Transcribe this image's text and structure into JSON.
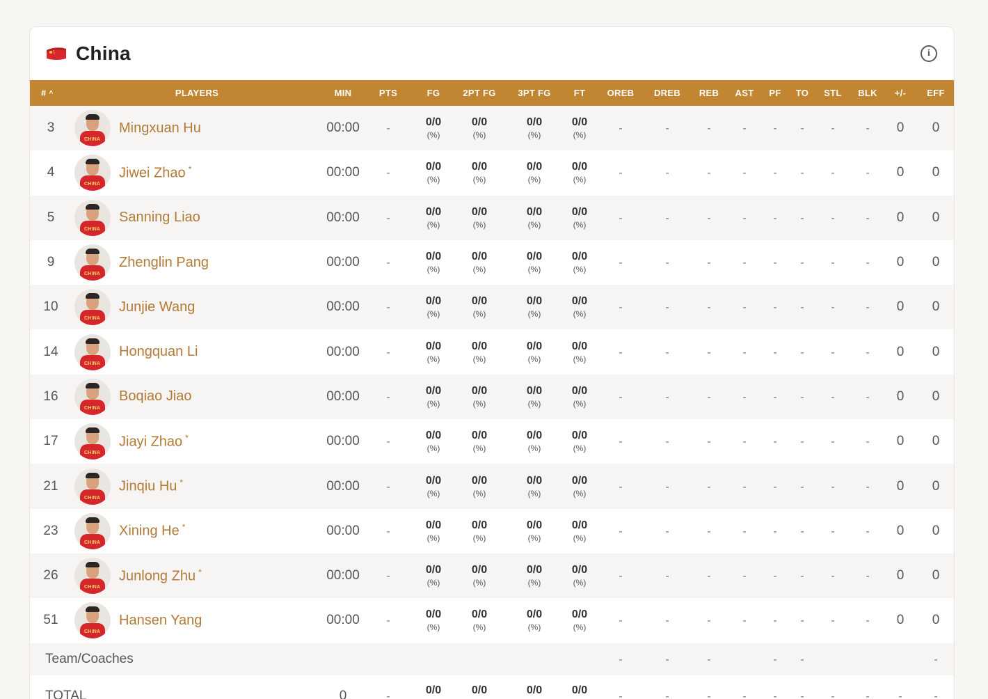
{
  "team": {
    "name": "China",
    "flag_icon": "china-flag-icon",
    "info_icon": "info-icon"
  },
  "columns": {
    "num": "#",
    "players": "PLAYERS",
    "min": "MIN",
    "pts": "PTS",
    "fg": "FG",
    "fg2": "2PT FG",
    "fg3": "3PT FG",
    "ft": "FT",
    "oreb": "OREB",
    "dreb": "DREB",
    "reb": "REB",
    "ast": "AST",
    "pf": "PF",
    "to": "TO",
    "stl": "STL",
    "blk": "BLK",
    "pm": "+/-",
    "eff": "EFF"
  },
  "sort_indicator": "^",
  "players": [
    {
      "num": "3",
      "name": "Mingxuan Hu",
      "starter": false
    },
    {
      "num": "4",
      "name": "Jiwei Zhao",
      "starter": true
    },
    {
      "num": "5",
      "name": "Sanning Liao",
      "starter": false
    },
    {
      "num": "9",
      "name": "Zhenglin Pang",
      "starter": false
    },
    {
      "num": "10",
      "name": "Junjie Wang",
      "starter": false
    },
    {
      "num": "14",
      "name": "Hongquan Li",
      "starter": false
    },
    {
      "num": "16",
      "name": "Boqiao Jiao",
      "starter": false
    },
    {
      "num": "17",
      "name": "Jiayi Zhao",
      "starter": true
    },
    {
      "num": "21",
      "name": "Jinqiu Hu",
      "starter": true
    },
    {
      "num": "23",
      "name": "Xining He",
      "starter": true
    },
    {
      "num": "26",
      "name": "Junlong Zhu",
      "starter": true
    },
    {
      "num": "51",
      "name": "Hansen Yang",
      "starter": false
    }
  ],
  "stat_defaults": {
    "min": "00:00",
    "pts": "-",
    "shot_made": "0/0",
    "shot_pct": "(%)",
    "dash": "-",
    "pm": "0",
    "eff": "0"
  },
  "starter_mark": "*",
  "avatar_jersey_text": "CHINA",
  "coaches_row": {
    "label": "Team/Coaches"
  },
  "total_row": {
    "label": "TOTAL",
    "min": "0",
    "pts": "-",
    "shot_made": "0/0",
    "shot_pct": "(%)"
  }
}
